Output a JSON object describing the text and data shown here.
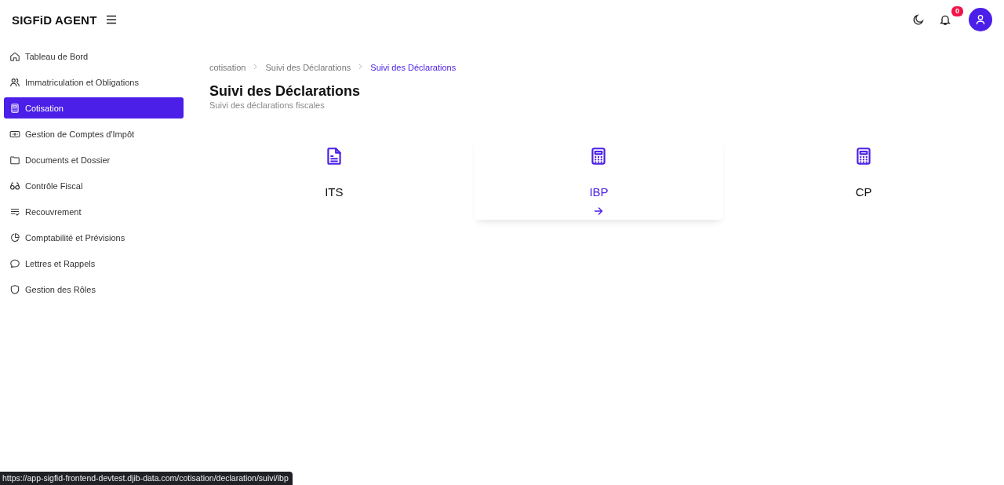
{
  "header": {
    "brand": "SIGFiD AGENT",
    "notifications": {
      "count": "0"
    }
  },
  "sidebar": {
    "items": [
      {
        "label": "Tableau de Bord",
        "kind": "home",
        "selected": false
      },
      {
        "label": "Immatriculation et Obligations",
        "kind": "users",
        "selected": false
      },
      {
        "label": "Cotisation",
        "kind": "calculator",
        "selected": true
      },
      {
        "label": "Gestion de Comptes d'Impôt",
        "kind": "cash",
        "selected": false
      },
      {
        "label": "Documents et Dossier",
        "kind": "folder",
        "selected": false
      },
      {
        "label": "Contrôle Fiscal",
        "kind": "glasses",
        "selected": false
      },
      {
        "label": "Recouvrement",
        "kind": "checklist",
        "selected": false
      },
      {
        "label": "Comptabilité et Prévisions",
        "kind": "pie",
        "selected": false
      },
      {
        "label": "Lettres et Rappels",
        "kind": "chat",
        "selected": false
      },
      {
        "label": "Gestion des Rôles",
        "kind": "shield",
        "selected": false
      }
    ]
  },
  "breadcrumb": [
    {
      "label": "cotisation",
      "selected": false
    },
    {
      "label": "Suivi des Déclarations",
      "selected": false
    },
    {
      "label": "Suivi des Déclarations",
      "selected": true
    }
  ],
  "page": {
    "title": "Suivi des Déclarations",
    "subtitle": "Suivi des déclarations fiscales"
  },
  "cards": [
    {
      "label": "ITS",
      "kind": "document",
      "hovered": false
    },
    {
      "label": "IBP",
      "kind": "calculator",
      "hovered": true
    },
    {
      "label": "CP",
      "kind": "calculator",
      "hovered": false
    }
  ],
  "status_bar": {
    "url": "https://app-sigfid-frontend-devtest.djib-data.com/cotisation/declaration/suivi/ibp"
  }
}
